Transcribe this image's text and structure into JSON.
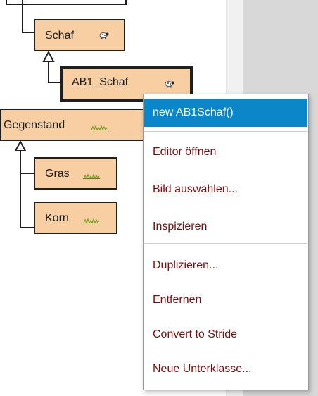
{
  "diagram": {
    "classes": [
      {
        "label": "Schaf",
        "icon": "sheep-icon"
      },
      {
        "label": "AB1_Schaf",
        "icon": "sheep-icon",
        "selected": true
      },
      {
        "label": "Gegenstand",
        "icon": "grass-icon"
      },
      {
        "label": "Gras",
        "icon": "grass-icon"
      },
      {
        "label": "Korn",
        "icon": "grass-icon"
      }
    ]
  },
  "context_menu": {
    "items": [
      {
        "label": "new AB1Schaf()",
        "active": true
      },
      {
        "label": "Editor öffnen"
      },
      {
        "label": "Bild auswählen..."
      },
      {
        "label": "Inspizieren"
      },
      {
        "label": "Duplizieren..."
      },
      {
        "label": "Entfernen"
      },
      {
        "label": "Convert to Stride"
      },
      {
        "label": "Neue Unterklasse..."
      }
    ]
  },
  "colors": {
    "class_box_fill": "#f7cfa3",
    "menu_highlight": "#0b86c9",
    "menu_text": "#7a0d0d",
    "background_panel": "#d8d8d8"
  }
}
